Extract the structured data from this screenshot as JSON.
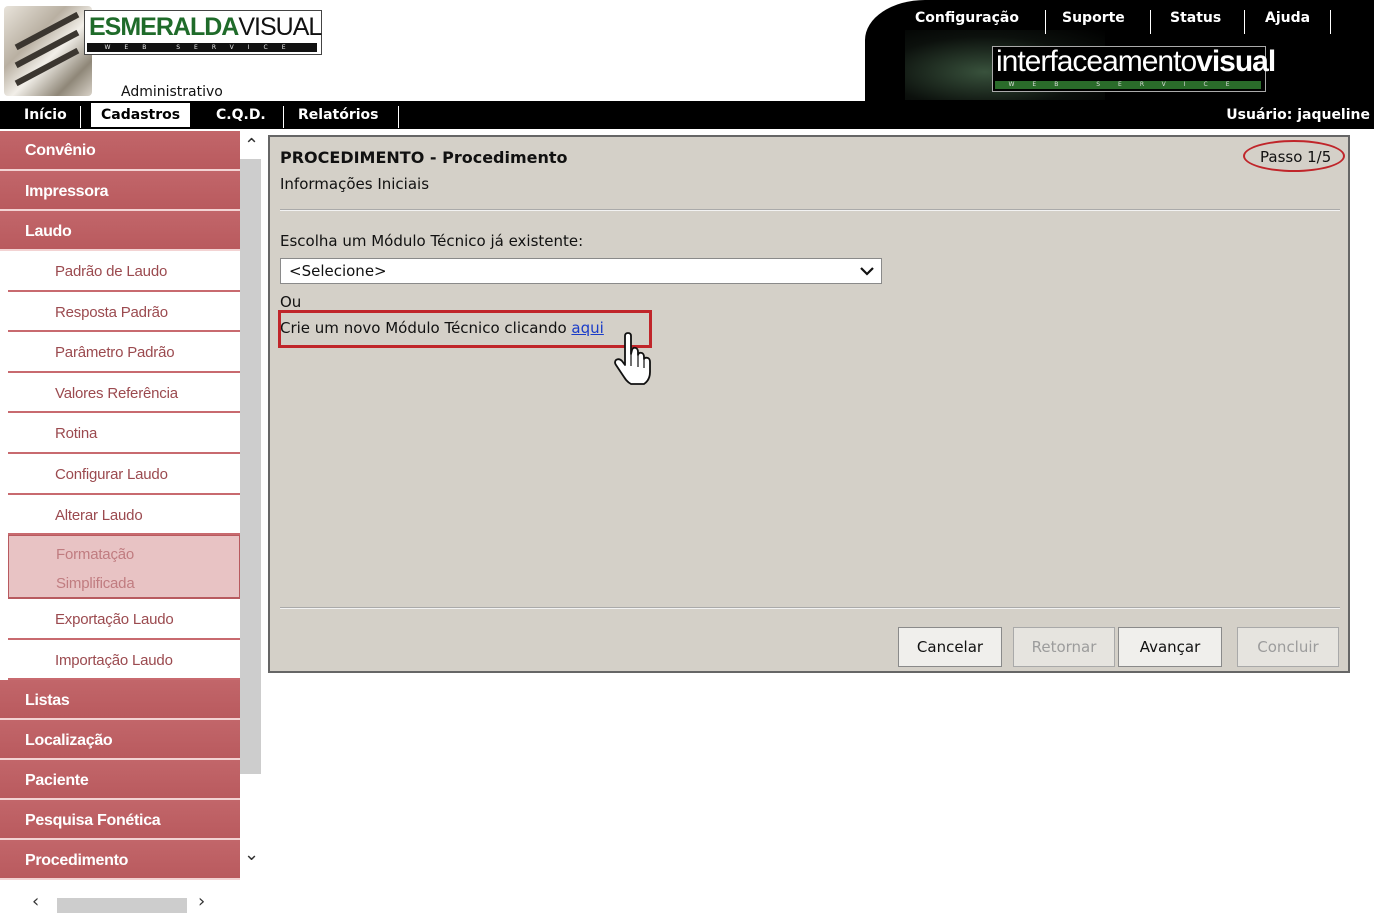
{
  "header": {
    "logo_title_bold": "ESMERALDA",
    "logo_title_thin": "VISUAL",
    "logo_strip": "WEB SERVICE",
    "logo_subtitle": "Administrativo",
    "top_menu": [
      "Configuração",
      "Suporte",
      "Status",
      "Ajuda"
    ],
    "brand2_thin": "interfaceamento",
    "brand2_bold": "visual",
    "brand2_strip": "WEB SERVICE"
  },
  "nav": {
    "items": [
      "Início",
      "Cadastros",
      "C.Q.D.",
      "Relatórios"
    ],
    "active": "Cadastros",
    "user": "Usuário: jaqueline"
  },
  "sidebar": {
    "cat_1": "Convênio",
    "cat_2": "Impressora",
    "cat_3": "Laudo",
    "subitems": [
      "Padrão de Laudo",
      "Resposta Padrão",
      "Parâmetro Padrão",
      "Valores Referência",
      "Rotina",
      "Configurar Laudo",
      "Alterar Laudo"
    ],
    "selected_line1": "Formatação",
    "selected_line2": "Simplificada",
    "subitems2": [
      "Exportação Laudo",
      "Importação Laudo"
    ],
    "cats_after": [
      "Listas",
      "Localização",
      "Paciente",
      "Pesquisa Fonética",
      "Procedimento"
    ]
  },
  "panel": {
    "title": "PROCEDIMENTO - Procedimento",
    "subtitle": "Informações Iniciais",
    "step": "Passo 1/5",
    "choose_label": "Escolha um Módulo Técnico já existente:",
    "select_value": "<Selecione>",
    "or_label": "Ou",
    "create_prefix": "Crie um novo Módulo Técnico clicando ",
    "create_link": "aqui",
    "buttons": {
      "cancel": "Cancelar",
      "back": "Retornar",
      "next": "Avançar",
      "finish": "Concluir"
    }
  },
  "colors": {
    "sidebar_category": "#bd5f63",
    "sidebar_text": "#9b4a4f",
    "panel_bg": "#d4d0c8",
    "highlight": "#c0252a",
    "link": "#1a3cc8"
  },
  "icons": [
    "hand-pointer-icon",
    "chevron-down-icon",
    "scroll-up-arrow-icon",
    "scroll-down-arrow-icon",
    "scroll-left-arrow-icon",
    "scroll-right-arrow-icon"
  ]
}
